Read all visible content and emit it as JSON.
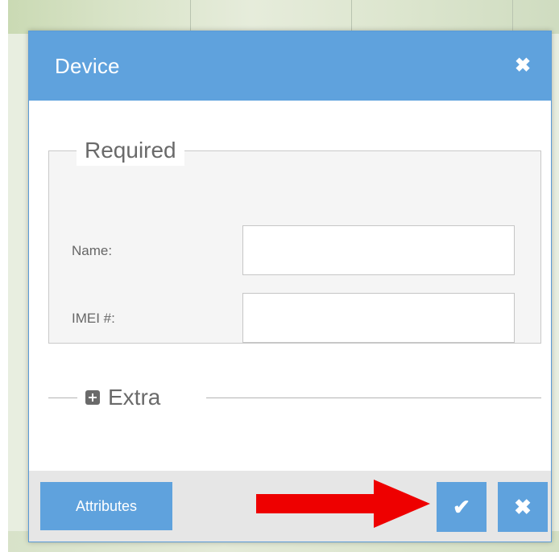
{
  "dialog": {
    "title": "Device",
    "close_icon": "close-icon",
    "accent_color": "#5fa2dd"
  },
  "required": {
    "legend": "Required",
    "fields": [
      {
        "label": "Name:",
        "value": "",
        "placeholder": ""
      },
      {
        "label": "IMEI #:",
        "value": "",
        "placeholder": ""
      }
    ]
  },
  "extra": {
    "label": "Extra",
    "icon": "plus-square-icon",
    "expanded": false
  },
  "footer": {
    "attributes_label": "Attributes",
    "confirm_icon": "check-icon",
    "cancel_icon": "close-icon"
  },
  "annotation": {
    "arrow_icon": "right-arrow-icon",
    "arrow_color": "#ee0000"
  }
}
